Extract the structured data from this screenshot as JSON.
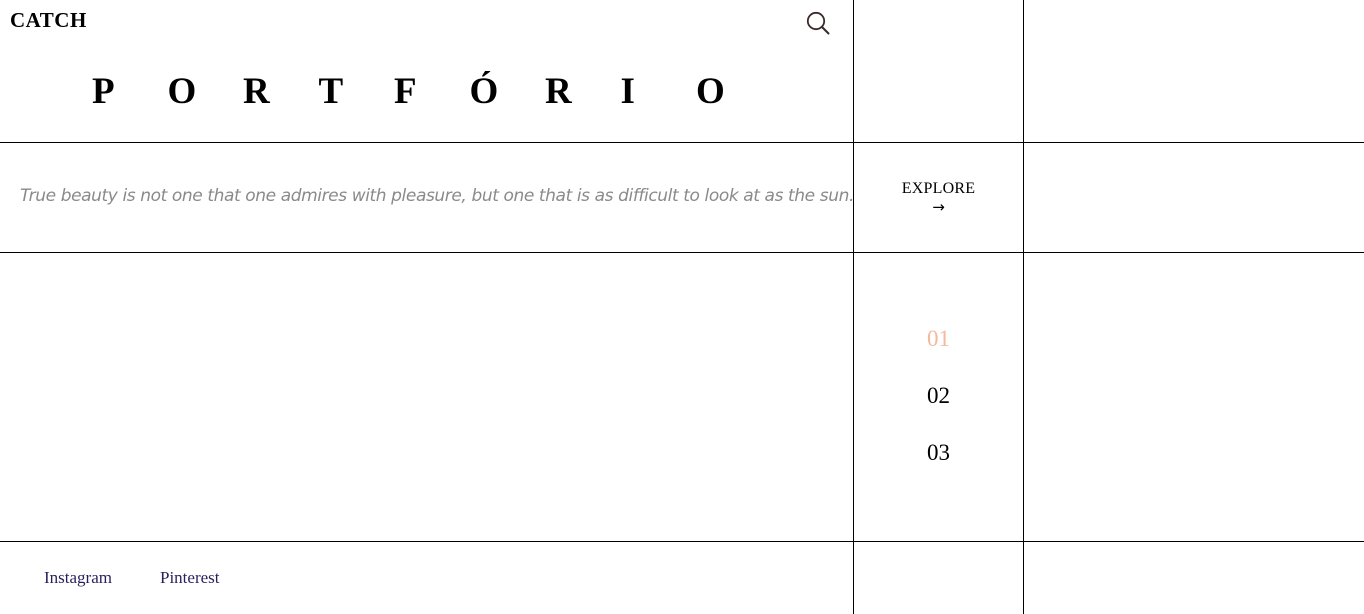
{
  "header": {
    "brand": "CATCH",
    "search_icon": "search-icon"
  },
  "hero": {
    "title_letters": [
      "P",
      "O",
      "R",
      "T",
      "F",
      "Ó",
      "R",
      "I",
      "O"
    ]
  },
  "quote": {
    "text": "True beauty is not one that one admires with pleasure, but one that is as difficult to look at as the sun."
  },
  "explore": {
    "label": "EXPLORE",
    "arrow": "→",
    "icon": "arrow-right-icon"
  },
  "pagination": {
    "items": [
      "01",
      "02",
      "03"
    ],
    "active_index": 0,
    "active_color": "#f2b99c"
  },
  "footer": {
    "links": [
      "Instagram",
      "Pinterest"
    ],
    "link_color": "#2a1f5c"
  }
}
